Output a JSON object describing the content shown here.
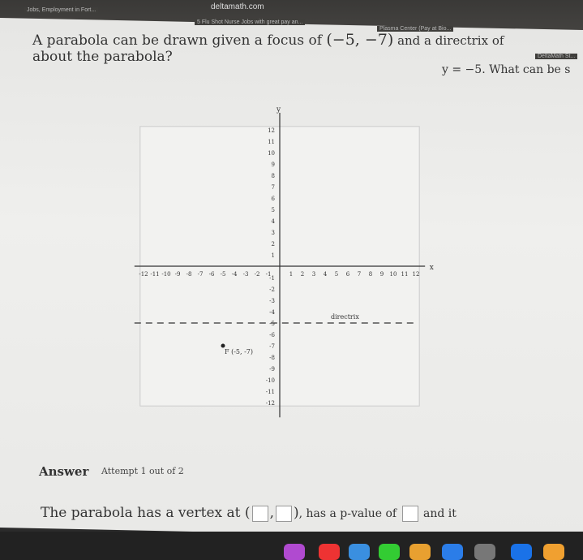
{
  "browser": {
    "url": "deltamath.com",
    "tabs": [
      "Jobs, Employment in Fort...",
      "5 Flu Shot Nurse Jobs with great pay an...",
      "Plasma Center (Pay at Bio...",
      "DeltaMath St..."
    ]
  },
  "question": {
    "line1_a": "A parabola can be drawn given a focus of ",
    "focus": "(−5, −7)",
    "line1_b": " and a directrix of ",
    "directrix": "y = −5",
    "line1_c": ". What can be s",
    "line2": "about the parabola?"
  },
  "graph": {
    "x_label": "x",
    "y_label": "y",
    "x_ticks": [
      -12,
      -11,
      -10,
      -9,
      -8,
      -7,
      -6,
      -5,
      -4,
      -3,
      -2,
      -1,
      1,
      2,
      3,
      4,
      5,
      6,
      7,
      8,
      9,
      10,
      11,
      12
    ],
    "y_ticks": [
      12,
      11,
      10,
      9,
      8,
      7,
      6,
      5,
      4,
      3,
      2,
      1,
      -1,
      -2,
      -3,
      -4,
      -5,
      -6,
      -7,
      -8,
      -9,
      -10,
      -11,
      -12
    ],
    "focus": {
      "x": -5,
      "y": -7,
      "label": "F (-5, -7)"
    },
    "directrix": {
      "y": -5,
      "label": "directrix"
    }
  },
  "answer": {
    "label": "Answer",
    "attempt": "Attempt 1 out of 2",
    "sentence_a": "The parabola has a vertex at ",
    "sentence_b": ", has a p-value of ",
    "sentence_c": " and it"
  }
}
